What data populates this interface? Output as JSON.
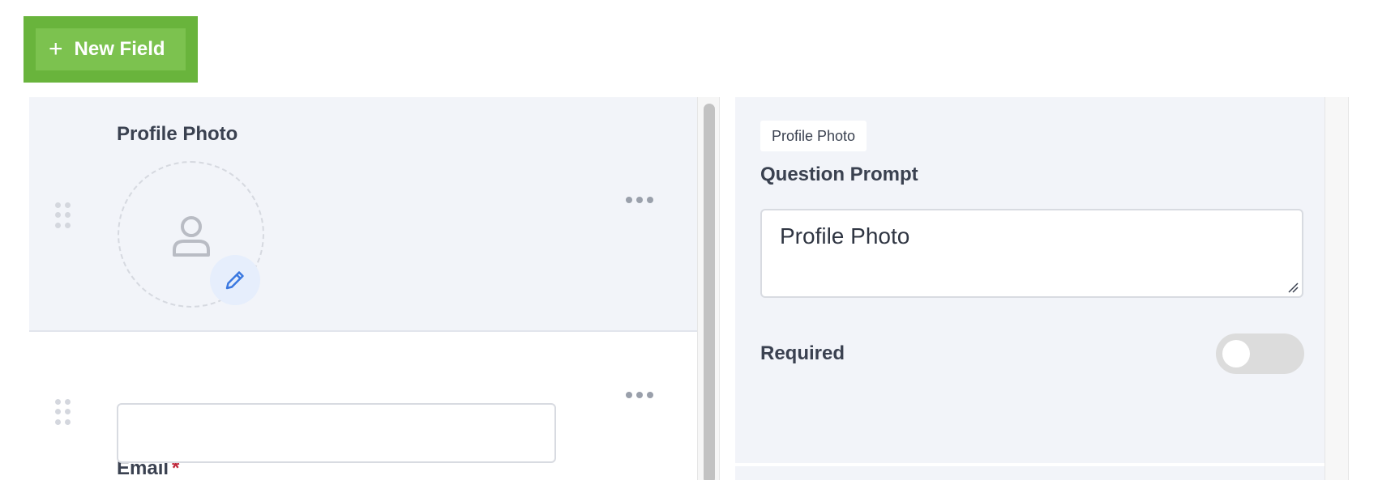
{
  "toolbar": {
    "new_field_label": "New Field",
    "plus_glyph": "+"
  },
  "fields": [
    {
      "label": "Profile Photo",
      "type": "photo",
      "selected": true,
      "required": false
    },
    {
      "label": "Email",
      "type": "text",
      "selected": false,
      "required": true,
      "value": ""
    }
  ],
  "required_marker": "*",
  "settings": {
    "type_tag": "Profile Photo",
    "prompt_label": "Question Prompt",
    "prompt_value": "Profile Photo",
    "required_label": "Required",
    "required_on": false
  },
  "icons": {
    "add": "plus-icon",
    "drag": "drag-handle-icon",
    "more": "more-horizontal-icon",
    "avatar": "person-icon",
    "edit": "pencil-icon"
  },
  "colors": {
    "button_green": "#69b43c",
    "button_green_inner": "#7cc24f",
    "selected_row_bg": "#f2f4f9",
    "required_red": "#c0283b",
    "edit_blue": "#3a78e0"
  }
}
